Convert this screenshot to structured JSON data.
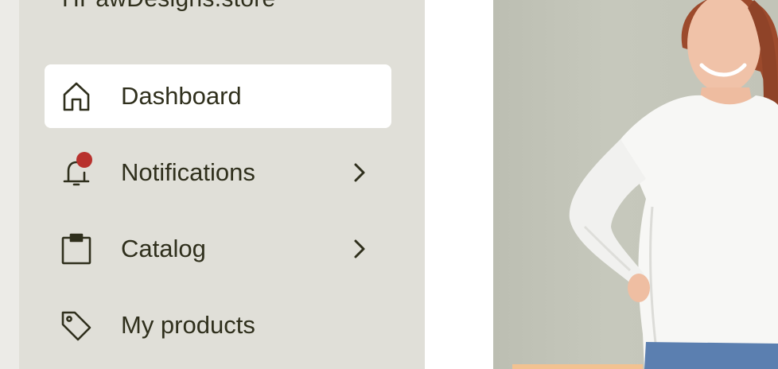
{
  "store": {
    "name": "HPawDesigns.store"
  },
  "nav": {
    "items": [
      {
        "label": "Dashboard",
        "icon": "home-icon",
        "active": true,
        "has_chevron": false
      },
      {
        "label": "Notifications",
        "icon": "bell-icon",
        "active": false,
        "has_chevron": true,
        "badge": true
      },
      {
        "label": "Catalog",
        "icon": "clipboard-icon",
        "active": false,
        "has_chevron": true
      },
      {
        "label": "My products",
        "icon": "tag-icon",
        "active": false,
        "has_chevron": false
      }
    ]
  },
  "colors": {
    "sidebar_bg": "#e0dfd8",
    "active_bg": "#ffffff",
    "text": "#2f2f1c",
    "badge": "#b8312d",
    "promo_accent": "#f2c291"
  }
}
